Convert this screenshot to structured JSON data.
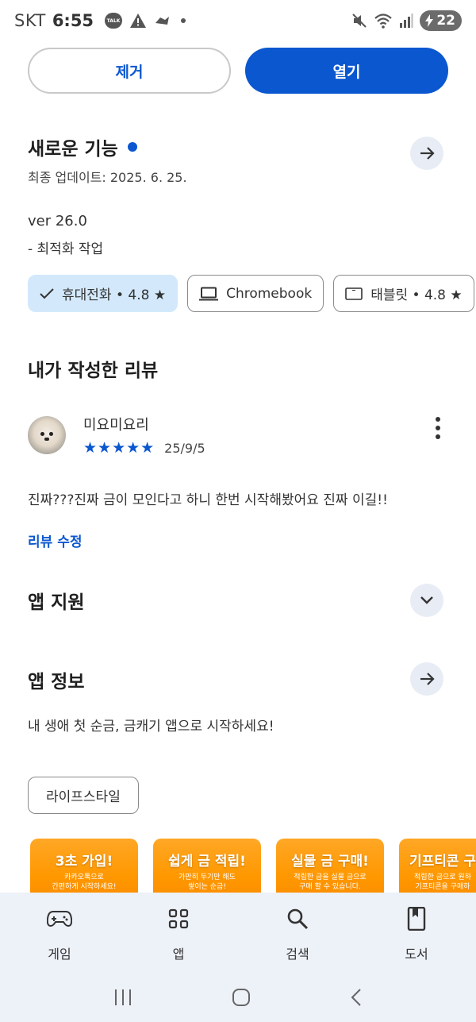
{
  "status_bar": {
    "carrier": "SKT",
    "time": "6:55",
    "talk_label": "TALK",
    "battery": "22"
  },
  "actions": {
    "remove_label": "제거",
    "open_label": "열기"
  },
  "whats_new": {
    "title": "새로운 기능",
    "last_updated": "최종 업데이트: 2025. 6. 25.",
    "version": "ver 26.0",
    "note": "- 최적화 작업"
  },
  "devices": [
    {
      "label": "휴대전화 • 4.8 ★",
      "icon": "check-icon",
      "selected": true
    },
    {
      "label": "Chromebook",
      "icon": "laptop-icon",
      "selected": false
    },
    {
      "label": "태블릿 • 4.8 ★",
      "icon": "tablet-icon",
      "selected": false
    }
  ],
  "my_review": {
    "title": "내가 작성한 리뷰",
    "reviewer_name": "미요미요리",
    "rating_stars": 5,
    "stars": "★★★★★",
    "date": "25/9/5",
    "text": "진짜???진짜 금이 모인다고 하니 한번 시작해봤어요 진짜 이길!!",
    "edit_label": "리뷰 수정"
  },
  "app_support": {
    "title": "앱 지원"
  },
  "app_info": {
    "title": "앱 정보",
    "description": "내 생애 첫 순금, 금캐기 앱으로 시작하세요!",
    "category": "라이프스타일"
  },
  "screenshots": [
    {
      "title": "3초 가입!",
      "subtitle": "카카오톡으로\n간편하게 시작하세요!"
    },
    {
      "title": "쉽게 금 적립!",
      "subtitle": "가만히 두기만 해도\n쌓이는 순금!"
    },
    {
      "title": "실물 금 구매!",
      "subtitle": "적립한 금을 실물 금으로\n구매 할 수 있습니다."
    },
    {
      "title": "기프티콘 구",
      "subtitle": "적립한 금으로 원하\n기프티콘을 구매하"
    }
  ],
  "bottom_nav": [
    {
      "label": "게임",
      "icon": "gamepad-icon"
    },
    {
      "label": "앱",
      "icon": "apps-grid-icon"
    },
    {
      "label": "검색",
      "icon": "search-icon"
    },
    {
      "label": "도서",
      "icon": "book-icon"
    }
  ],
  "colors": {
    "accent": "#0b57d0",
    "chip_selected": "#d3e9fb",
    "nav_background": "#edf1f8",
    "screenshot_orange": "#ff9800"
  }
}
